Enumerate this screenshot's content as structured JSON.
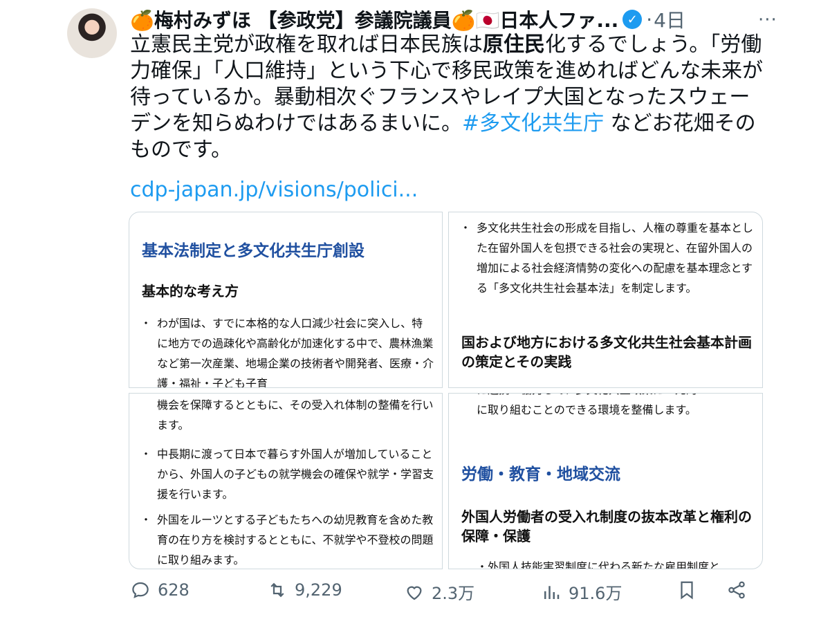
{
  "author": {
    "name": "🍊梅村みずほ 【参政党】参議院議員🍊🇯🇵日本人ファ...",
    "verified": "✓",
    "time": "4日",
    "separator": "·"
  },
  "tweet": {
    "seg1": "立憲民主党が政権を取れば日本民族は",
    "bold": "原住民",
    "seg2": "化するでしょう。「労働力確保」「人口維持」という下心で移民政策を進めればどんな未来が待っているか。暴動相次ぐフランスやレイプ大国となったスウェーデンを知らぬわけではあるまいに。",
    "hashtag": "#多文化共生庁",
    "seg3": " などお花畑そのものです。",
    "link": "cdp-japan.jp/visions/polici..."
  },
  "cards": {
    "tl": {
      "title": "基本法制定と多文化共生庁創設",
      "sub": "基本的な考え方",
      "bullet": "わが国は、すでに本格的な人口減少社会に突入し、特に地方での過疎化や高齢化が加速化する中で、農林漁業など第一次産業、地場企業の技術者や開発者、医療・介護・福祉・子ども子育"
    },
    "tr": {
      "bullet": "多文化共生社会の形成を目指し、人権の尊重を基本とした在留外国人を包摂できる社会の実現と、在留外国人の増加による社会経済情勢の変化への配慮を基本理念とする「多文化共生社会基本法」を制定します。",
      "sub": "国および地方における多文化共生社会基本計画の策定とその実践"
    },
    "bl": {
      "cont": "機会を保障するとともに、その受入れ体制の整備を行います。",
      "b1": "中長期に渡って日本で暮らす外国人が増加していることから、外国人の子どもの就学機会の確保や就学・学習支援を行います。",
      "b2": "外国をルーツとする子どもたちへの幼児教育を含めた教育の在り方を検討するとともに、不就学や不登校の問題に取り組みます。"
    },
    "br": {
      "cut": "に連携・協力して、多文化共生政策に一元的",
      "cont": "に取り組むことのできる環境を整備します。",
      "title": "労働・教育・地域交流",
      "sub": "外国人労働者の受入れ制度の抜本改革と権利の保障・保護",
      "cut2": "・外国人技能実習制度に代わる新たな雇用制度と"
    }
  },
  "actions": {
    "replies": "628",
    "retweets": "9,229",
    "likes": "2.3万",
    "views": "91.6万"
  },
  "colors": {
    "link": "#1d9bf0",
    "card_title": "#2050a0",
    "muted": "#536471"
  }
}
